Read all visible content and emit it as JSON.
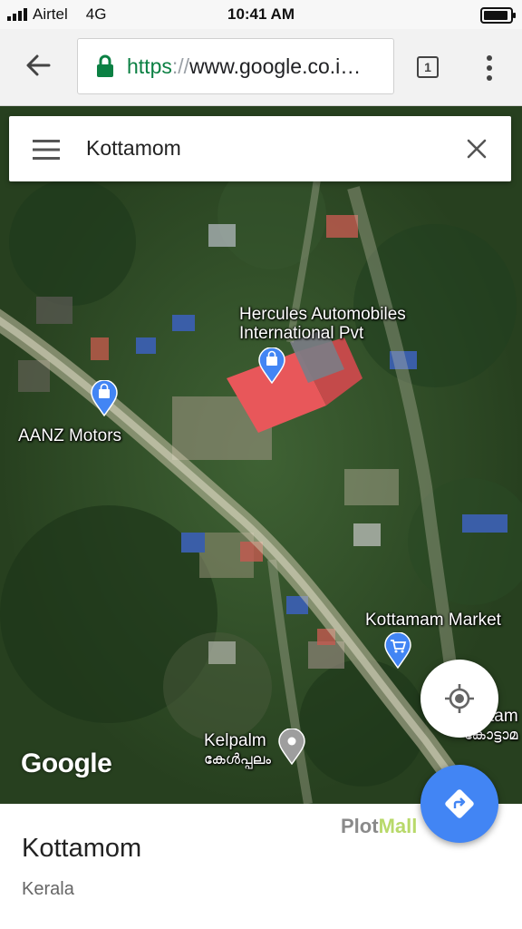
{
  "status_bar": {
    "carrier": "Airtel",
    "network": "4G",
    "time": "10:41 AM"
  },
  "browser": {
    "url_protocol": "https",
    "url_separator": "://",
    "url_host": "www.google.co.i…",
    "tab_count": "1"
  },
  "search": {
    "query": "Kottamom"
  },
  "map": {
    "places": [
      {
        "name": "Hercules Automobiles\nInternational Pvt",
        "icon": "shopping-bag-pin"
      },
      {
        "name": "AANZ Motors",
        "icon": "shopping-bag-pin"
      },
      {
        "name": "Kottamam Market",
        "icon": "shopping-cart-pin"
      },
      {
        "name": "Kelpalm",
        "name_local": "കേൾപ്പലം",
        "icon": "location-pin"
      },
      {
        "name": "tam",
        "name_local": "കോട്ടാമ"
      }
    ],
    "logo_text": "Google",
    "colors": {
      "pin_blue": "#4285f4",
      "pin_gray": "#9e9e9e",
      "roof_red": "#e8575a"
    }
  },
  "place_sheet": {
    "title": "Kottamom",
    "subtitle": "Kerala"
  },
  "watermark": {
    "part1": "Plot",
    "part2": "Mall"
  }
}
